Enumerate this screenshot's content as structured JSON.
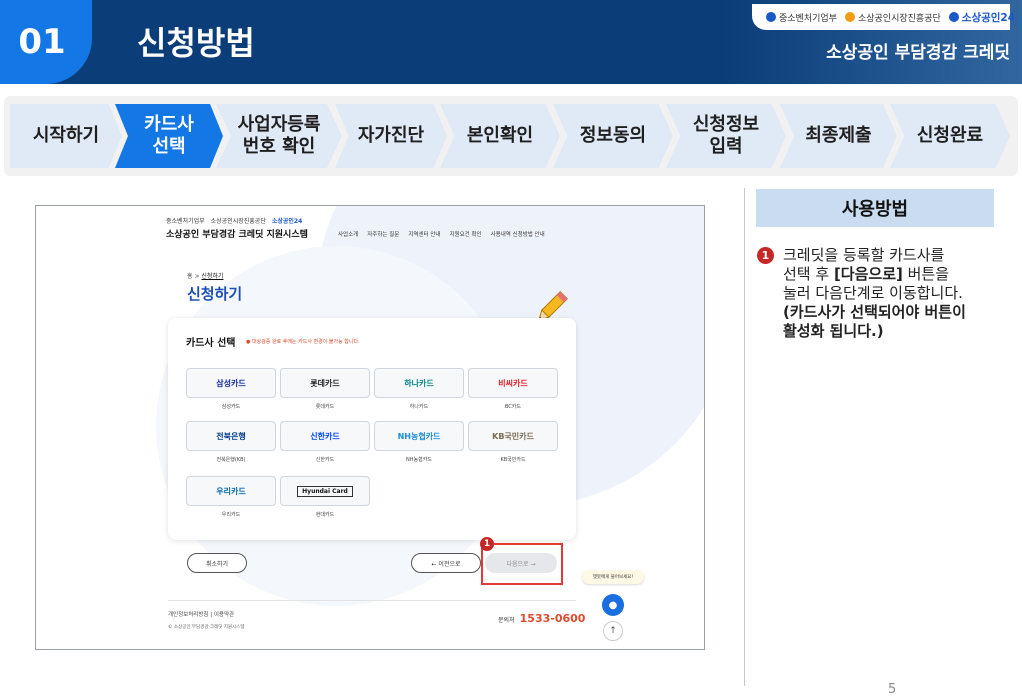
{
  "header": {
    "section_number": "01",
    "title": "신청방법",
    "subtitle": "소상공인 부담경감 크레딧",
    "logos": [
      "중소벤처기업부",
      "소상공인시장진흥공단",
      "소상공인24"
    ]
  },
  "steps": [
    {
      "label": "시작하기",
      "active": false
    },
    {
      "label": "카드사\n선택",
      "active": true
    },
    {
      "label": "사업자등록\n번호 확인",
      "active": false
    },
    {
      "label": "자가진단",
      "active": false
    },
    {
      "label": "본인확인",
      "active": false
    },
    {
      "label": "정보동의",
      "active": false
    },
    {
      "label": "신청정보\n입력",
      "active": false
    },
    {
      "label": "최종제출",
      "active": false
    },
    {
      "label": "신청완료",
      "active": false
    }
  ],
  "screenshot": {
    "site_logos": [
      "중소벤처기업부",
      "소상공인시장진흥공단",
      "소상공인24"
    ],
    "site_name": "소상공인 부담경감 크레딧 지원시스템",
    "nav": [
      "사업소개",
      "자주하는 질문",
      "지역센터 안내",
      "지원요건 확인",
      "사용내역 신청방법 안내"
    ],
    "breadcrumb": {
      "home": "홈",
      "current": "신청하기"
    },
    "page_title": "신청하기",
    "card_title": "카드사 선택",
    "card_note": "● 대상검증 완료 후에는 카드사 변경이 불가능 합니다.",
    "cards": [
      {
        "logo": "삼성카드",
        "label": "삼성카드",
        "color": "#1428a0"
      },
      {
        "logo": "롯데카드",
        "label": "롯데카드",
        "color": "#222222"
      },
      {
        "logo": "하나카드",
        "label": "하나카드",
        "color": "#008485"
      },
      {
        "logo": "비씨카드",
        "label": "BC카드",
        "color": "#e21b23"
      },
      {
        "logo": "전북은행",
        "label": "전북은행(KB)",
        "color": "#003c8f"
      },
      {
        "logo": "신한카드",
        "label": "신한카드",
        "color": "#0046ff"
      },
      {
        "logo": "NH농협카드",
        "label": "NH농협카드",
        "color": "#1a8dd6"
      },
      {
        "logo": "KB국민카드",
        "label": "KB국민카드",
        "color": "#7a6a53"
      },
      {
        "logo": "우리카드",
        "label": "우리카드",
        "color": "#0067ac"
      },
      {
        "logo": "Hyundai Card",
        "label": "현대카드",
        "color": "#111111"
      }
    ],
    "cancel_btn": "취소하기",
    "prev_btn": "← 이전으로",
    "next_btn": "다음으로 →",
    "step_badge": "1",
    "chat_bubble": "챗봇에게 물어보세요!",
    "footer_links": "개인정보처리방침  |  이용약관",
    "footer_copy": "© 소상공인 부담경감 크레딧 지원시스템",
    "phone_label": "문의처",
    "phone_number": "1533-0600"
  },
  "usage": {
    "header": "사용방법",
    "item_num": "1",
    "line1": "크레딧을 등록할 카드사를",
    "line2a": "선택 후 ",
    "line2b": "[다음으로]",
    "line2c": " 버튼을",
    "line3": "눌러 다음단계로 이동합니다.",
    "line4": "(카드사가 선택되어야 버튼이",
    "line5": "활성화 됩니다.)"
  },
  "page_number": "5",
  "colors": {
    "header_navy": "#0b3d78",
    "accent_blue": "#1378e6",
    "step_inactive": "#e0e9f6",
    "highlight_red": "#e53935",
    "usage_header_bg": "#c9dcf0"
  }
}
